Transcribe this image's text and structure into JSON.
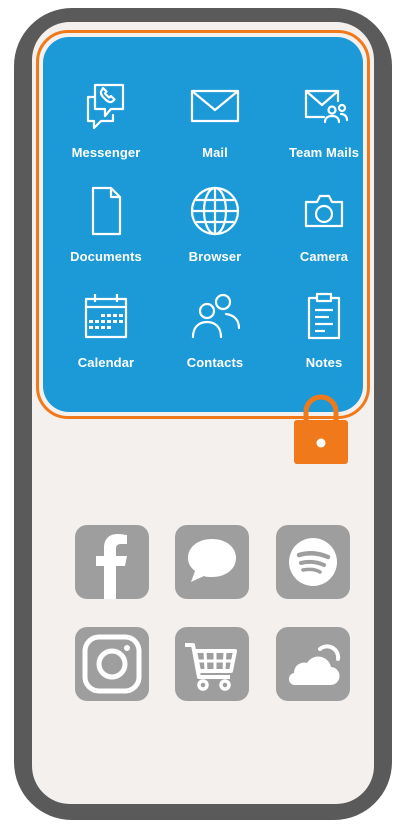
{
  "secure_apps": [
    {
      "label": "Messenger",
      "icon": "messenger-icon"
    },
    {
      "label": "Mail",
      "icon": "mail-icon"
    },
    {
      "label": "Team Mails",
      "icon": "team-mail-icon"
    },
    {
      "label": "Documents",
      "icon": "document-icon"
    },
    {
      "label": "Browser",
      "icon": "globe-icon"
    },
    {
      "label": "Camera",
      "icon": "camera-icon"
    },
    {
      "label": "Calendar",
      "icon": "calendar-icon"
    },
    {
      "label": "Contacts",
      "icon": "contacts-icon"
    },
    {
      "label": "Notes",
      "icon": "clipboard-icon"
    }
  ],
  "lock": {
    "icon": "padlock-icon",
    "color": "#F07A1B"
  },
  "personal_apps": [
    {
      "icon": "facebook-icon"
    },
    {
      "icon": "chat-bubble-icon"
    },
    {
      "icon": "spotify-icon"
    },
    {
      "icon": "instagram-icon"
    },
    {
      "icon": "shopping-cart-icon"
    },
    {
      "icon": "cloud-icon"
    }
  ],
  "colors": {
    "phone_frame": "#5A5A5A",
    "screen_background": "#F4F0EE",
    "secure_panel": "#1C9AD8",
    "secure_border": "#F07A1B",
    "app_tile": "#9E9E9E"
  }
}
